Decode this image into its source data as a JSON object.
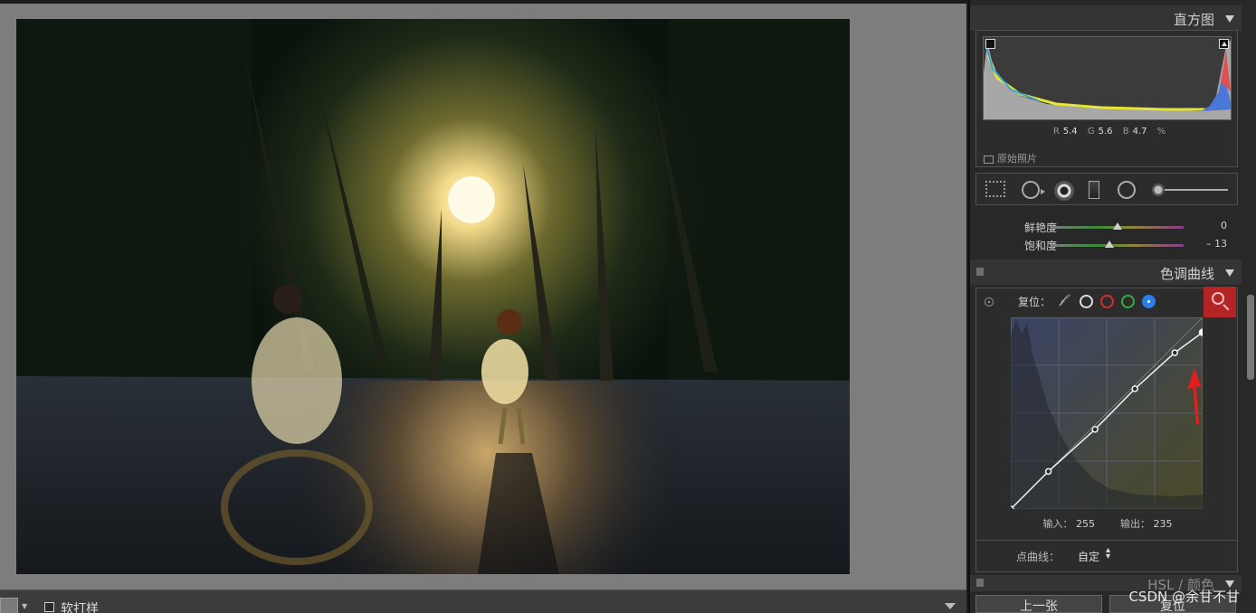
{
  "panels": {
    "histogram": {
      "title": "直方图",
      "r_label": "R",
      "r_value": "5.4",
      "g_label": "G",
      "g_value": "5.6",
      "b_label": "B",
      "b_value": "4.7",
      "unit": "%",
      "original_photo_label": "原始照片"
    },
    "basic_tail": {
      "vibrance_label": "鲜艳度",
      "vibrance_value": "0",
      "saturation_label": "饱和度",
      "saturation_value": "– 13",
      "vibrance_level": 0,
      "saturation_level": -13
    },
    "tone_curve": {
      "title": "色调曲线",
      "reset_label": "复位：",
      "input_label": "输入：",
      "input_value": "255",
      "output_label": "输出：",
      "output_value": "235",
      "point_curve_label": "点曲线：",
      "point_curve_value": "自定",
      "selected_channel": "blue",
      "curve_points": [
        [
          0,
          0
        ],
        [
          50,
          50
        ],
        [
          112,
          106
        ],
        [
          165,
          160
        ],
        [
          218,
          208
        ],
        [
          255,
          235
        ]
      ]
    },
    "hsl": {
      "title": "HSL / 颜色"
    }
  },
  "toolbar": {
    "soft_proof_label": "软打样"
  },
  "footer_buttons": {
    "prev_label": "上一张",
    "reset_label": "复位"
  },
  "watermark": "CSDN @余甘不甘",
  "icons": {
    "clip_shadow": "clipping-shadow-icon",
    "clip_highlight": "clipping-highlight-icon",
    "zoom": "magnifier-icon"
  },
  "colors": {
    "zoom_highlight": "#b32424",
    "annotation_arrow": "#e02020",
    "blue_channel": "#2a7ee8"
  }
}
